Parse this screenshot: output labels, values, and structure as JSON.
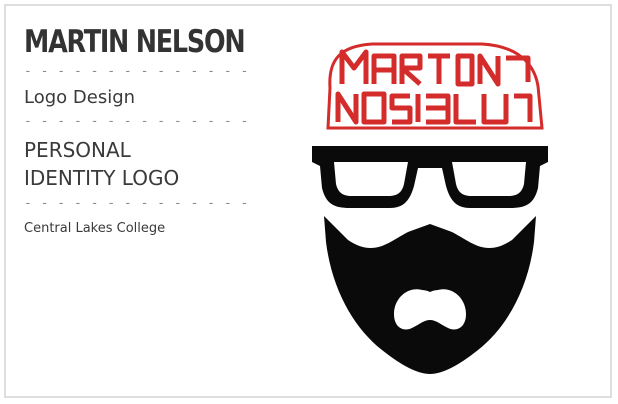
{
  "card": {
    "name": "MARTIN NELSON",
    "divider": "- - - - - - - - - - - - - -",
    "category": "Logo Design",
    "title_line1": "PERSONAL",
    "title_line2": "IDENTITY LOGO",
    "school": "Central Lakes College"
  },
  "artwork": {
    "description_icon": "bearded-face-logo-icon",
    "hat_lettering": "Martin Nelson",
    "colors": {
      "hat_red": "#d42b2b",
      "ink_black": "#0a0a0a",
      "background": "#ffffff"
    }
  }
}
